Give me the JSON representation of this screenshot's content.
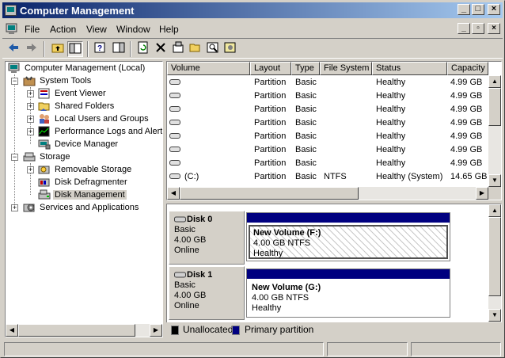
{
  "window": {
    "title": "Computer Management"
  },
  "caption_buttons": {
    "minimize": "_",
    "maximize": "□",
    "close": "×"
  },
  "menu": [
    {
      "label": "File",
      "key": "F"
    },
    {
      "label": "Action",
      "key": "A"
    },
    {
      "label": "View",
      "key": "V"
    },
    {
      "label": "Window",
      "key": "W"
    },
    {
      "label": "Help",
      "key": "H"
    }
  ],
  "toolbar": {
    "back": "back-arrow-icon",
    "forward": "forward-arrow-icon",
    "up": "up-folder-icon",
    "show_tree": "show-hide-tree-icon",
    "help": "help-icon",
    "show_pane": "show-pane-icon",
    "refresh": "refresh-icon",
    "delete": "delete-icon",
    "properties": "properties-icon",
    "open": "open-folder-icon",
    "search": "search-icon",
    "settings": "settings-icon"
  },
  "tree": {
    "root": "Computer Management (Local)",
    "system_tools": "System Tools",
    "event_viewer": "Event Viewer",
    "shared_folders": "Shared Folders",
    "local_users": "Local Users and Groups",
    "perf_logs": "Performance Logs and Alerts",
    "device_manager": "Device Manager",
    "storage": "Storage",
    "removable_storage": "Removable Storage",
    "disk_defrag": "Disk Defragmenter",
    "disk_management": "Disk Management",
    "services": "Services and Applications"
  },
  "volume_list": {
    "columns": [
      "Volume",
      "Layout",
      "Type",
      "File System",
      "Status",
      "Capacity"
    ],
    "rows": [
      {
        "volume": "",
        "layout": "Partition",
        "type": "Basic",
        "fs": "",
        "status": "Healthy",
        "capacity": "4.99 GB"
      },
      {
        "volume": "",
        "layout": "Partition",
        "type": "Basic",
        "fs": "",
        "status": "Healthy",
        "capacity": "4.99 GB"
      },
      {
        "volume": "",
        "layout": "Partition",
        "type": "Basic",
        "fs": "",
        "status": "Healthy",
        "capacity": "4.99 GB"
      },
      {
        "volume": "",
        "layout": "Partition",
        "type": "Basic",
        "fs": "",
        "status": "Healthy",
        "capacity": "4.99 GB"
      },
      {
        "volume": "",
        "layout": "Partition",
        "type": "Basic",
        "fs": "",
        "status": "Healthy",
        "capacity": "4.99 GB"
      },
      {
        "volume": "",
        "layout": "Partition",
        "type": "Basic",
        "fs": "",
        "status": "Healthy",
        "capacity": "4.99 GB"
      },
      {
        "volume": "",
        "layout": "Partition",
        "type": "Basic",
        "fs": "",
        "status": "Healthy",
        "capacity": "4.99 GB"
      },
      {
        "volume": "(C:)",
        "layout": "Partition",
        "type": "Basic",
        "fs": "NTFS",
        "status": "Healthy (System)",
        "capacity": "14.65 GB"
      }
    ]
  },
  "disks": [
    {
      "name": "Disk 0",
      "type": "Basic",
      "size": "4.00 GB",
      "state": "Online",
      "volume": {
        "name": "New Volume  (F:)",
        "detail": "4.00 GB NTFS",
        "status": "Healthy"
      }
    },
    {
      "name": "Disk 1",
      "type": "Basic",
      "size": "4.00 GB",
      "state": "Online",
      "volume": {
        "name": "New Volume  (G:)",
        "detail": "4.00 GB NTFS",
        "status": "Healthy"
      }
    }
  ],
  "legend": [
    {
      "label": "Unallocated",
      "color": "#000000"
    },
    {
      "label": "Primary partition",
      "color": "#000080"
    }
  ]
}
